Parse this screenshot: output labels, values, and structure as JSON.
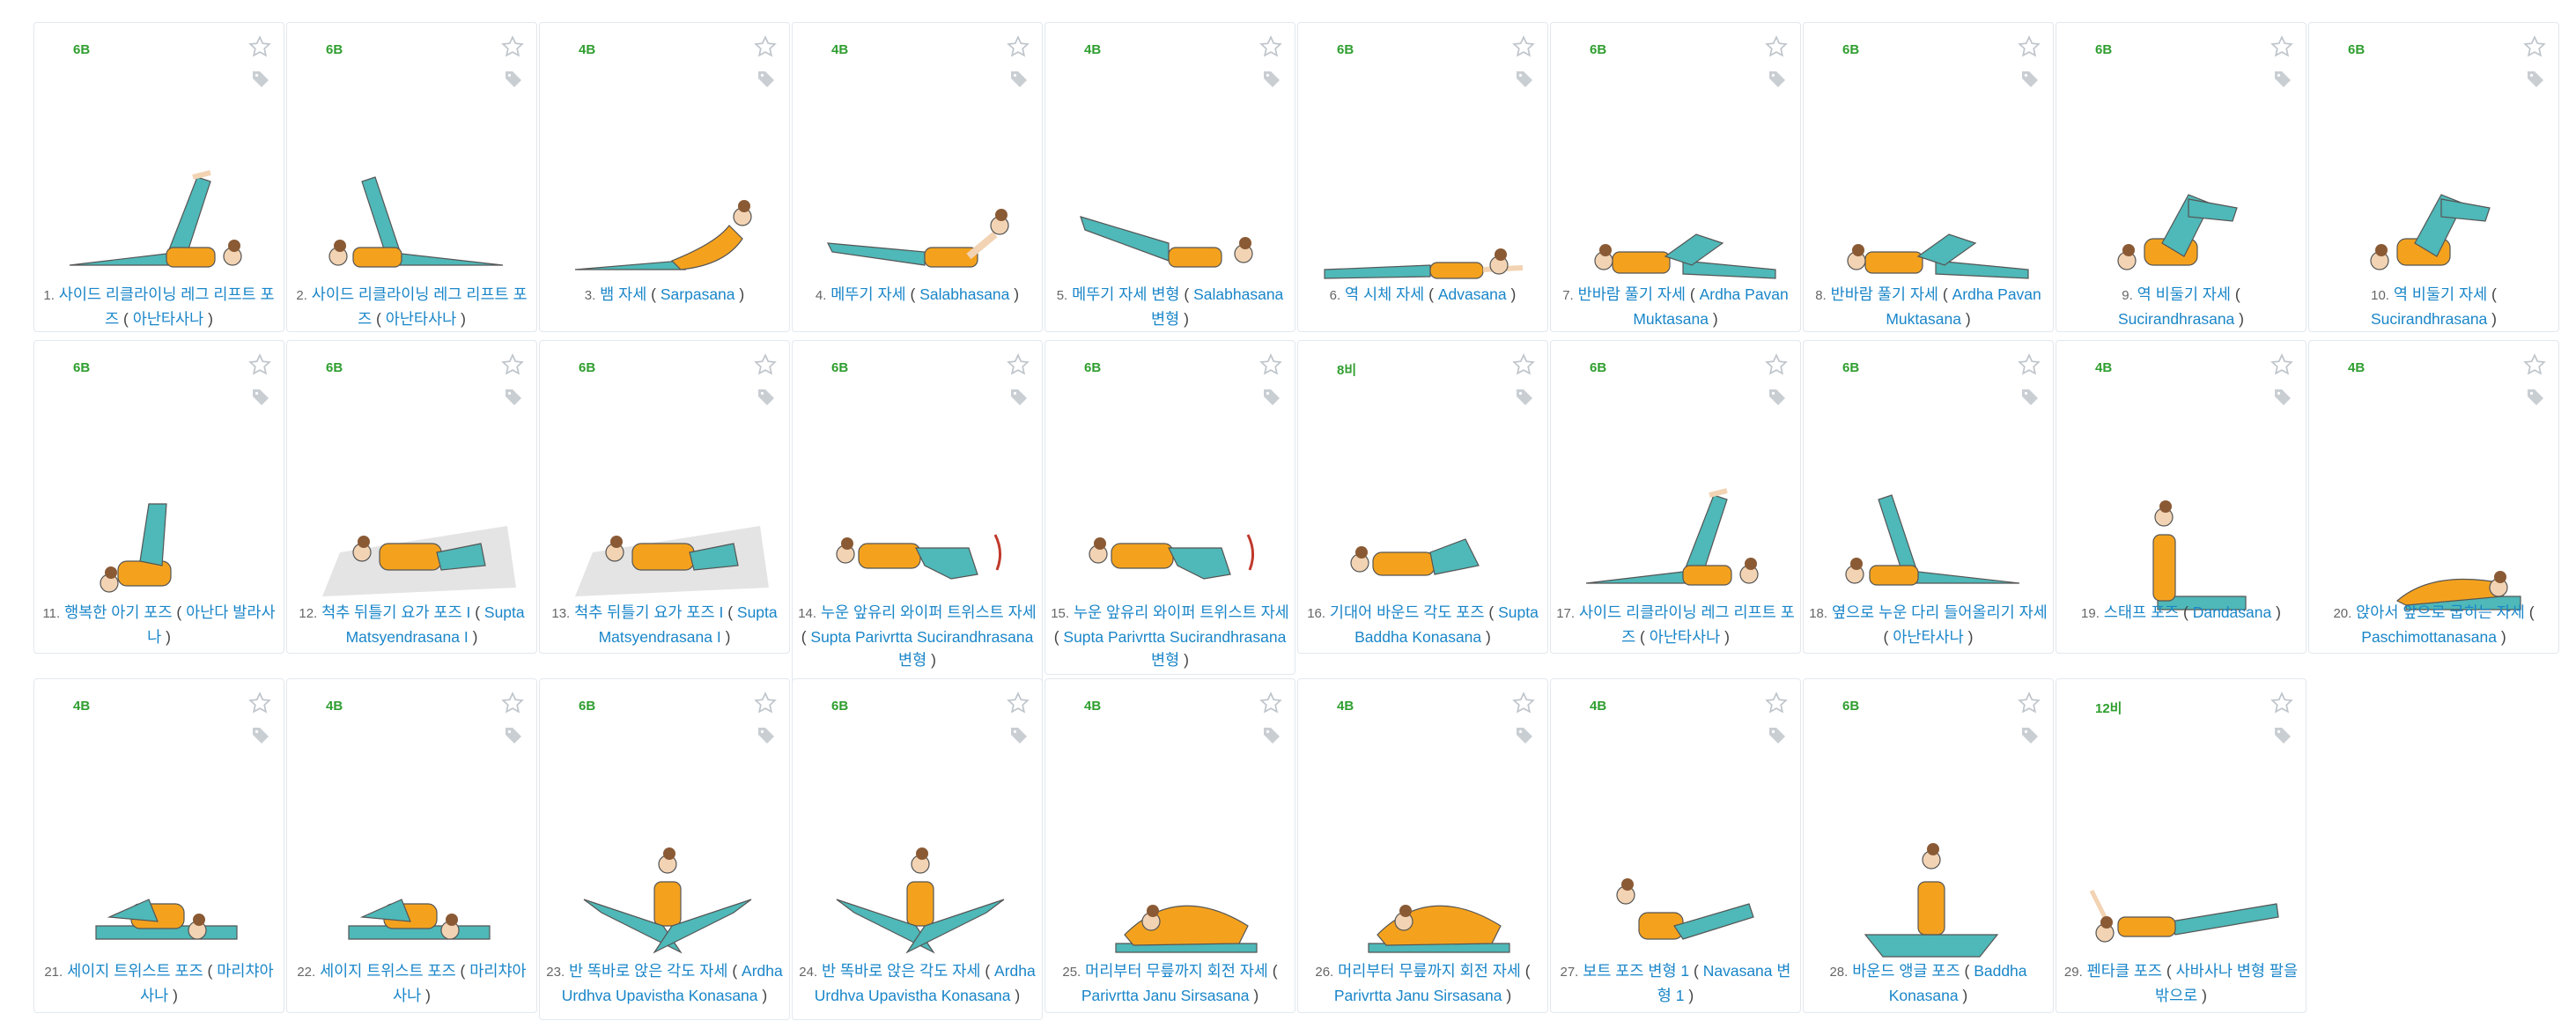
{
  "colors": {
    "link": "#1a86c9",
    "level": "#2f9e2f",
    "border": "#e2e8ee",
    "teal": "#4fb8b8",
    "orange": "#f4a21e",
    "skin": "#f2d3b3",
    "hair": "#8a5a35"
  },
  "cards": [
    {
      "num": "1.",
      "level": "6B",
      "name": "사이드 리클라이닝 레그 리프트 포즈",
      "alt": "아난타사나",
      "pose": "leglift"
    },
    {
      "num": "2.",
      "level": "6B",
      "name": "사이드 리클라이닝 레그 리프트 포즈",
      "alt": "아난타사나",
      "pose": "leglift2"
    },
    {
      "num": "3.",
      "level": "4B",
      "name": "뱀 자세",
      "alt": "Sarpasana",
      "pose": "snake"
    },
    {
      "num": "4.",
      "level": "4B",
      "name": "메뚜기 자세",
      "alt": "Salabhasana",
      "pose": "locust"
    },
    {
      "num": "5.",
      "level": "4B",
      "name": "메뚜기 자세 변형",
      "alt": "Salabhasana 변형",
      "pose": "locust2"
    },
    {
      "num": "6.",
      "level": "6B",
      "name": "역 시체 자세",
      "alt": "Advasana",
      "pose": "prone"
    },
    {
      "num": "7.",
      "level": "6B",
      "name": "반바람 풀기 자세",
      "alt": "Ardha Pavan Muktasana",
      "pose": "wind"
    },
    {
      "num": "8.",
      "level": "6B",
      "name": "반바람 풀기 자세",
      "alt": "Ardha Pavan Muktasana",
      "pose": "wind"
    },
    {
      "num": "9.",
      "level": "6B",
      "name": "역 비둘기 자세",
      "alt": "Sucirandhrasana",
      "pose": "pigeon"
    },
    {
      "num": "10.",
      "level": "6B",
      "name": "역 비둘기 자세",
      "alt": "Sucirandhrasana",
      "pose": "pigeon"
    },
    {
      "num": "11.",
      "level": "6B",
      "name": "행복한 아기 포즈",
      "alt": "아난다 발라사나",
      "pose": "baby"
    },
    {
      "num": "12.",
      "level": "6B",
      "name": "척추 뒤틀기 요가 포즈 I",
      "alt": "Supta Matsyendrasana I",
      "pose": "twist"
    },
    {
      "num": "13.",
      "level": "6B",
      "name": "척추 뒤틀기 요가 포즈 I",
      "alt": "Supta Matsyendrasana I",
      "pose": "twist"
    },
    {
      "num": "14.",
      "level": "6B",
      "name": "누운 앞유리 와이퍼 트위스트 자세",
      "alt": "Supta Parivrtta Sucirandhrasana 변형",
      "pose": "wiper"
    },
    {
      "num": "15.",
      "level": "6B",
      "name": "누운 앞유리 와이퍼 트위스트 자세",
      "alt": "Supta Parivrtta Sucirandhrasana 변형",
      "pose": "wiper"
    },
    {
      "num": "16.",
      "level": "8비",
      "name": "기대어 바운드 각도 포즈",
      "alt": "Supta Baddha Konasana",
      "pose": "bound"
    },
    {
      "num": "17.",
      "level": "6B",
      "name": "사이드 리클라이닝 레그 리프트 포즈",
      "alt": "아난타사나",
      "pose": "leglift"
    },
    {
      "num": "18.",
      "level": "6B",
      "name": "옆으로 누운 다리 들어올리기 자세",
      "alt": "아난타사나",
      "pose": "leglift2"
    },
    {
      "num": "19.",
      "level": "4B",
      "name": "스태프 포즈",
      "alt": "Dandasana",
      "pose": "staff"
    },
    {
      "num": "20.",
      "level": "4B",
      "name": "앉아서 앞으로 굽히는 자세",
      "alt": "Paschimottanasana",
      "pose": "fold"
    },
    {
      "num": "21.",
      "level": "4B",
      "name": "세이지 트위스트 포즈",
      "alt": "마리챠아사나",
      "pose": "sage"
    },
    {
      "num": "22.",
      "level": "4B",
      "name": "세이지 트위스트 포즈",
      "alt": "마리챠아사나",
      "pose": "sage"
    },
    {
      "num": "23.",
      "level": "6B",
      "name": "반 똑바로 앉은 각도 자세",
      "alt": "Ardha Urdhva Upavistha Konasana",
      "pose": "angle"
    },
    {
      "num": "24.",
      "level": "6B",
      "name": "반 똑바로 앉은 각도 자세",
      "alt": "Ardha Urdhva Upavistha Konasana",
      "pose": "angle"
    },
    {
      "num": "25.",
      "level": "4B",
      "name": "머리부터 무릎까지 회전 자세",
      "alt": "Parivrtta Janu Sirsasana",
      "pose": "revolve"
    },
    {
      "num": "26.",
      "level": "4B",
      "name": "머리부터 무릎까지 회전 자세",
      "alt": "Parivrtta Janu Sirsasana",
      "pose": "revolve"
    },
    {
      "num": "27.",
      "level": "4B",
      "name": "보트 포즈 변형 1",
      "alt": "Navasana 변형 1",
      "pose": "boat"
    },
    {
      "num": "28.",
      "level": "6B",
      "name": "바운드 앵글 포즈",
      "alt": "Baddha Konasana",
      "pose": "cobbler"
    },
    {
      "num": "29.",
      "level": "12비",
      "name": "펜타클 포즈",
      "alt": "사바사나 변형 팔을 밖으로",
      "pose": "pentacle"
    }
  ]
}
